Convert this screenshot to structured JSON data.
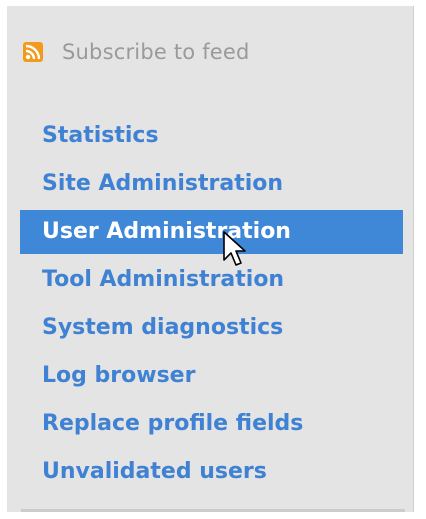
{
  "feed": {
    "label": "Subscribe to feed",
    "icon": "rss-icon"
  },
  "menu": {
    "items": [
      {
        "label": "Statistics",
        "active": false
      },
      {
        "label": "Site Administration",
        "active": false
      },
      {
        "label": "User Administration",
        "active": true
      },
      {
        "label": "Tool Administration",
        "active": false
      },
      {
        "label": "System diagnostics",
        "active": false
      },
      {
        "label": "Log browser",
        "active": false
      },
      {
        "label": "Replace profile fields",
        "active": false
      },
      {
        "label": "Unvalidated users",
        "active": false
      }
    ]
  },
  "colors": {
    "link": "#3f81d3",
    "highlight": "#3f88d8",
    "panel_background": "#e4e4e4",
    "rss_orange": "#f39a1c"
  }
}
